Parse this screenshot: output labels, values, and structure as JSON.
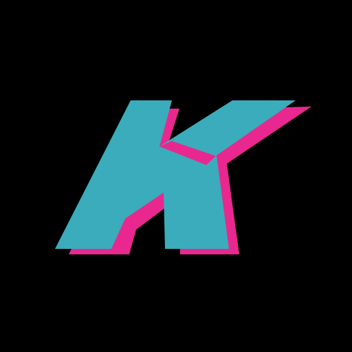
{
  "logo": {
    "glyph": "K",
    "icon_name": "k-letter-logo-icon",
    "colors": {
      "background": "#000000",
      "shadow": "#E8288F",
      "face": "#3AACBB"
    }
  }
}
